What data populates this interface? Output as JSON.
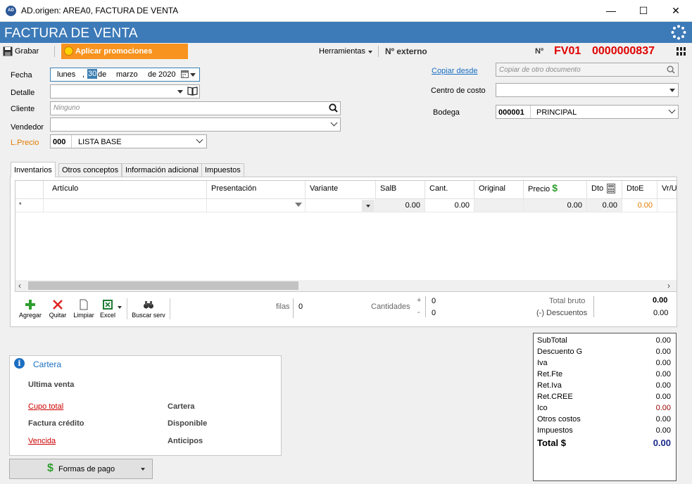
{
  "window": {
    "title": "AD.origen: AREA0, FACTURA DE VENTA",
    "app_icon": "AD",
    "minimize": "—",
    "maximize": "☐",
    "close": "✕"
  },
  "header": {
    "title": "FACTURA DE VENTA"
  },
  "toolbar": {
    "save_label": "Grabar",
    "promo_label": "Aplicar promociones",
    "tools_label": "Herramientas",
    "external_label": "Nº externo",
    "number_label": "Nº",
    "prefix": "FV01",
    "number": "0000000837"
  },
  "form": {
    "fecha_label": "Fecha",
    "fecha": {
      "weekday": "lunes",
      "sep": ",",
      "day": "30",
      "de1": "de",
      "month": "marzo",
      "de2": "de",
      "year": "2020"
    },
    "detalle_label": "Detalle",
    "detalle_value": "",
    "cliente_label": "Cliente",
    "cliente_placeholder": "Ninguno",
    "vendedor_label": "Vendedor",
    "vendedor_value": "",
    "lprecio_label": "L.Precio",
    "lprecio_code": "000",
    "lprecio_name": "LISTA BASE",
    "copiar_label": "Copiar desde",
    "copiar_placeholder": "Copiar de otro documento",
    "centro_label": "Centro de costo",
    "centro_value": "",
    "bodega_label": "Bodega",
    "bodega_code": "000001",
    "bodega_name": "PRINCIPAL"
  },
  "tabs": [
    {
      "label": "Inventarios",
      "active": true
    },
    {
      "label": "Otros conceptos",
      "active": false
    },
    {
      "label": "Información adicional",
      "active": false
    },
    {
      "label": "Impuestos",
      "active": false
    }
  ],
  "grid": {
    "columns": [
      "Artículo",
      "Presentación",
      "Variante",
      "SalB",
      "Cant.",
      "Original",
      "Precio",
      "Dto",
      "DtoE",
      "Vr/U"
    ],
    "new_row_marker": "*",
    "row": {
      "salb": "0.00",
      "cant": "0.00",
      "original": "",
      "precio": "0.00",
      "dto": "0.00",
      "dtoe": "0.00"
    }
  },
  "grid_toolbar": {
    "add": "Agregar",
    "remove": "Quitar",
    "clear": "Limpiar",
    "excel": "Excel",
    "search": "Buscar serv",
    "filas_label": "filas",
    "filas_value": "0",
    "cantidades_label": "Cantidades",
    "plus": "+",
    "minus": "-",
    "cant_plus": "0",
    "cant_minus": "0",
    "total_bruto_label": "Total bruto",
    "total_bruto": "0.00",
    "descuentos_label": "(-) Descuentos",
    "descuentos": "0.00"
  },
  "totals": [
    {
      "label": "SubTotal",
      "value": "0.00"
    },
    {
      "label": "Descuento G",
      "value": "0.00"
    },
    {
      "label": "Iva",
      "value": "0.00"
    },
    {
      "label": "Ret.Fte",
      "value": "0.00"
    },
    {
      "label": "Ret.Iva",
      "value": "0.00"
    },
    {
      "label": "Ret.CREE",
      "value": "0.00"
    },
    {
      "label": "Ico",
      "value": "0.00"
    },
    {
      "label": "Otros costos",
      "value": "0.00"
    },
    {
      "label": "Impuestos",
      "value": "0.00"
    },
    {
      "label": "Total $",
      "value": "0.00"
    }
  ],
  "cartera": {
    "title": "Cartera",
    "info_icon": "i",
    "ultima_venta": "Ultima venta",
    "cupo_total": "Cupo total",
    "factura_credito": "Factura crédito",
    "vencida": "Vencida",
    "cartera_label": "Cartera",
    "disponible": "Disponible",
    "anticipos": "Anticipos"
  },
  "payment": {
    "label": "Formas de pago",
    "icon": "$"
  },
  "colors": {
    "header_blue": "#3d7ab8",
    "promo_orange": "#f7931e",
    "number_red": "#e00000",
    "link_blue": "#1a6fc2",
    "total_blue": "#1a2a8a"
  }
}
